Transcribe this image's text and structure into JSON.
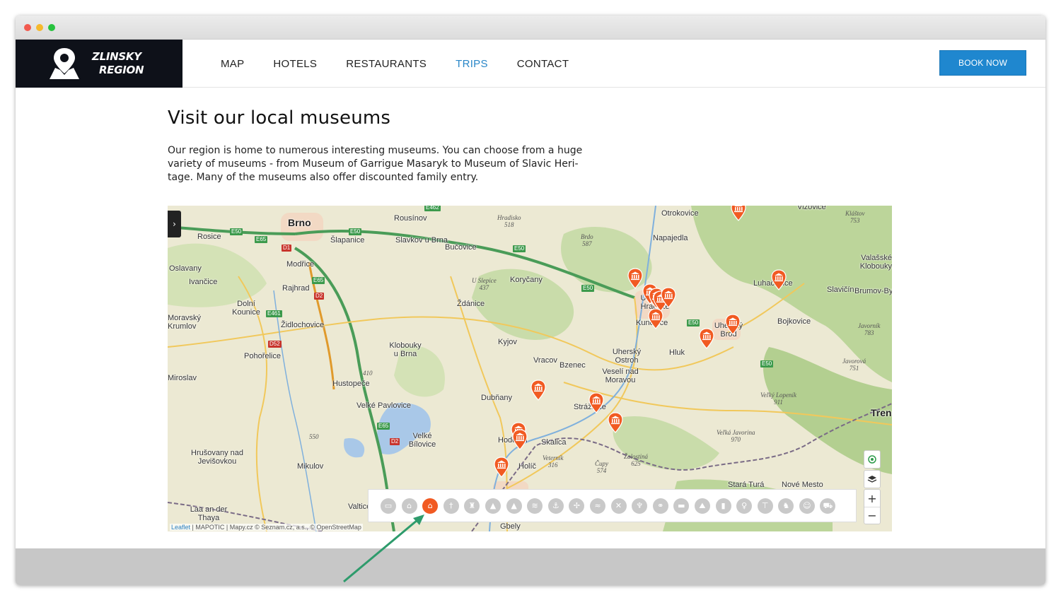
{
  "window": {
    "controls": [
      "close",
      "minimize",
      "maximize"
    ]
  },
  "brand": {
    "line1": "ZLINSKY",
    "line2": "REGION",
    "icon": "map-pin-icon"
  },
  "nav": {
    "items": [
      {
        "label": "MAP"
      },
      {
        "label": "HOTELS"
      },
      {
        "label": "RESTAURANTS"
      },
      {
        "label": "TRIPS",
        "active": true
      },
      {
        "label": "CONTACT"
      }
    ],
    "active_color": "#2a87c8"
  },
  "book_button": {
    "label": "BOOK NOW",
    "color": "#1f87cf"
  },
  "page": {
    "title": "Visit our local museums",
    "intro_lines": [
      "Our region is home to numerous interesting museums. You can choose from a huge",
      "variety of museums - from Museum of Garrigue Masaryk to Museum of Slavic Heri-",
      "tage. Many of the museums also offer discounted family entry."
    ]
  },
  "map": {
    "places": [
      "Brno",
      "Rousínov",
      "Otrokovice",
      "Vizovice",
      "Šlapanice",
      "Slavkov u Brna",
      "Bučovice",
      "Napajedla",
      "Rosice",
      "Modřice",
      "Koryčany",
      "Oslavany",
      "Ivančice",
      "Rajhrad",
      "Luhačovice",
      "Slavičín",
      "Valašské Klobouky",
      "Brumov-Bylnice",
      "Ždánice",
      "Uherské Hradiště",
      "Kunovice",
      "Uherský Brod",
      "Dolní Kounice",
      "Moravský Krumlov",
      "Židlochovice",
      "Bojkovice",
      "Kyjov",
      "Pohořelice",
      "Hluk",
      "Klobouky u Brna",
      "Vracov",
      "Bzenec",
      "Uherský Ostroh",
      "Veselí nad Moravou",
      "Miroslav",
      "Hustopeče",
      "Dubňany",
      "Strážnice",
      "Velké Pavlovice",
      "Velké Bílovice",
      "Hodonín",
      "Skalica",
      "Hrušovany nad Jevišovkou",
      "Mikulov",
      "Holíč",
      "Stará Turá",
      "Nové Mesto",
      "Trenčín",
      "Laa an der Thaya",
      "Valtice",
      "Gbely"
    ],
    "hills": [
      {
        "name": "Hradisko",
        "elev": "518"
      },
      {
        "name": "Brdo",
        "elev": "587"
      },
      {
        "name": "U Slepice",
        "elev": "437"
      },
      {
        "name": "Kláštov",
        "elev": "753"
      },
      {
        "name": "Javorník",
        "elev": "783"
      },
      {
        "name": "Žalostiná",
        "elev": "625"
      },
      {
        "name": "Veterník",
        "elev": "316"
      },
      {
        "name": "Čupy",
        "elev": "574"
      },
      {
        "name": "Veľký Lopeník",
        "elev": "911"
      },
      {
        "name": "Veľká Javorina",
        "elev": "970"
      },
      {
        "name": "Javorová",
        "elev": "751"
      },
      {
        "name": "",
        "elev": "410"
      },
      {
        "name": "",
        "elev": "550"
      }
    ],
    "roads": [
      "E50",
      "E65",
      "D1",
      "D2",
      "E461",
      "D52",
      "E65",
      "E50",
      "E50",
      "E50",
      "E65",
      "D2",
      "E50",
      "E50",
      "E462"
    ],
    "marker_icon": "museum-icon",
    "marker_color": "#f15a22",
    "marker_count": 18,
    "sidebar_toggle": "›",
    "zoom_in": "+",
    "zoom_out": "−",
    "categories": [
      {
        "icon": "bed-icon",
        "glyph": "▭"
      },
      {
        "icon": "museum-icon",
        "glyph": "⌂"
      },
      {
        "icon": "museum-icon",
        "glyph": "⌂",
        "active": true
      },
      {
        "icon": "church-icon",
        "glyph": "†"
      },
      {
        "icon": "castle-icon",
        "glyph": "♜"
      },
      {
        "icon": "tent-icon",
        "glyph": "▲"
      },
      {
        "icon": "camping-icon",
        "glyph": "▲"
      },
      {
        "icon": "spa-icon",
        "glyph": "≋"
      },
      {
        "icon": "anchor-icon",
        "glyph": "⚓"
      },
      {
        "icon": "windmill-icon",
        "glyph": "✢"
      },
      {
        "icon": "swimming-icon",
        "glyph": "≈"
      },
      {
        "icon": "restaurant-icon",
        "glyph": "✕"
      },
      {
        "icon": "wine-icon",
        "glyph": "♆"
      },
      {
        "icon": "bicycle-icon",
        "glyph": "⚭"
      },
      {
        "icon": "ticket-icon",
        "glyph": "▬"
      },
      {
        "icon": "hiking-icon",
        "glyph": "⛰"
      },
      {
        "icon": "tower-icon",
        "glyph": "▮"
      },
      {
        "icon": "viewpoint-icon",
        "glyph": "♀"
      },
      {
        "icon": "signpost-icon",
        "glyph": "⊤"
      },
      {
        "icon": "zoo-icon",
        "glyph": "♞"
      },
      {
        "icon": "theatre-icon",
        "glyph": "☺"
      },
      {
        "icon": "shopping-cart-icon",
        "glyph": "⛟"
      }
    ],
    "attribution": {
      "leaflet": "Leaflet",
      "mapotic": "MAPOTIC",
      "mapy": "Mapy.cz",
      "rest": "© Seznam.cz, a.s., © OpenStreetMap"
    }
  },
  "annotation": {
    "arrow_color": "#2e9b6c"
  }
}
